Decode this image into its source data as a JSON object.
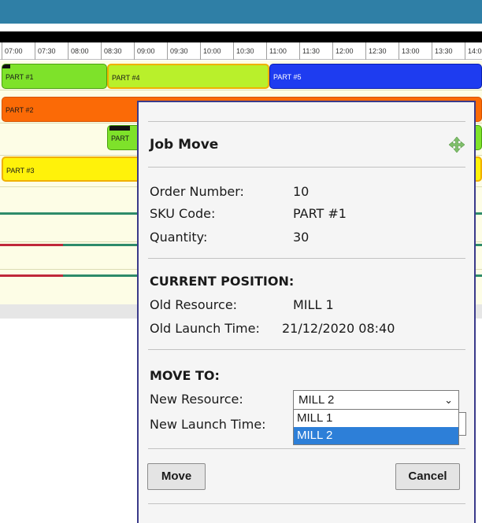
{
  "timeline": {
    "ticks": [
      "07:00",
      "07:30",
      "08:00",
      "08:30",
      "09:00",
      "09:30",
      "10:00",
      "10:30",
      "11:00",
      "11:30",
      "12:00",
      "12:30",
      "13:00",
      "13:30",
      "14:00"
    ]
  },
  "jobs": [
    {
      "label": "PART #1",
      "color": "#7ee22a"
    },
    {
      "label": "PART #4",
      "color": "#b9f02b"
    },
    {
      "label": "PART #5",
      "color": "#1e3cf0"
    },
    {
      "label": "PART #2",
      "color": "#fb6a06"
    },
    {
      "label": "PART",
      "color": "#7ee22a"
    },
    {
      "label": "PART #3",
      "color": "#fff20a"
    }
  ],
  "dialog": {
    "title": "Job Move",
    "order_number_label": "Order Number:",
    "order_number": "10",
    "sku_label": "SKU Code:",
    "sku": "PART #1",
    "quantity_label": "Quantity:",
    "quantity": "30",
    "current_heading": "CURRENT POSITION:",
    "old_resource_label": "Old Resource:",
    "old_resource": "MILL 1",
    "old_launch_label": "Old Launch Time:",
    "old_launch": "21/12/2020 08:40",
    "move_heading": "MOVE TO:",
    "new_resource_label": "New Resource:",
    "new_resource_value": "MILL 2",
    "new_launch_label": "New Launch Time:",
    "resource_options": [
      "MILL 1",
      "MILL 2"
    ],
    "move_button": "Move",
    "cancel_button": "Cancel"
  },
  "colors": {
    "accent_bar": "#2f7fa6",
    "dialog_border": "#3a3a8a",
    "selected_option": "#2d7fd8"
  }
}
